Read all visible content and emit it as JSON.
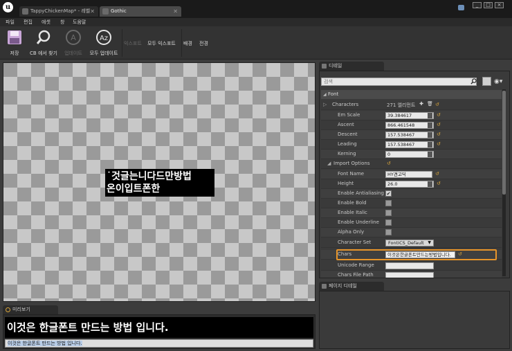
{
  "titlebar": {
    "tabs": [
      {
        "label": "TappyChickenMap* - 레벨"
      },
      {
        "label": "Gothic"
      }
    ],
    "window_controls": [
      "_",
      "□",
      "×"
    ]
  },
  "menu": [
    "파일",
    "편집",
    "애셋",
    "창",
    "도움말"
  ],
  "toolbar": {
    "save": "저장",
    "find_in_cb": "CB 에서 찾기",
    "update": "업데이트",
    "update_all": "모두 업데이트",
    "export": "익스포트",
    "export_all": "모두 익스포트",
    "background": "배경",
    "foreground": "전경"
  },
  "viewport": {
    "atlas_line1": "˙것글는니다드만방법",
    "atlas_line2": "온이입트폰한"
  },
  "preview": {
    "tab_label": "미리보기",
    "render_text": "이것은 한글폰트 만드는 방법 입니다.",
    "input_text": "이것은 한글폰트 만드는 방법 입니다."
  },
  "details": {
    "tab_label": "디테일",
    "search_placeholder": "검색",
    "section": "Font",
    "properties": {
      "characters_label": "Characters",
      "characters_value": "271 엘리먼트",
      "em_scale_label": "Em Scale",
      "em_scale_value": "39.384617",
      "ascent_label": "Ascent",
      "ascent_value": "866.461548",
      "descent_label": "Descent",
      "descent_value": "157.538467",
      "leading_label": "Leading",
      "leading_value": "157.538467",
      "kerning_label": "Kerning",
      "kerning_value": "0",
      "import_options_label": "Import Options",
      "font_name_label": "Font Name",
      "font_name_value": "HY견고딕",
      "height_label": "Height",
      "height_value": "26.0",
      "antialiasing_label": "Enable Antialiasing",
      "bold_label": "Enable Bold",
      "italic_label": "Enable Italic",
      "underline_label": "Enable Underline",
      "alpha_only_label": "Alpha Only",
      "charset_label": "Character Set",
      "charset_value": "FontICS_Default",
      "chars_label": "Chars",
      "chars_value": "이것은한글폰트만드는방법입니다.",
      "unicode_range_label": "Unicode Range",
      "chars_file_path_label": "Chars File Path"
    },
    "checkboxes": {
      "antialiasing": true,
      "bold": false,
      "italic": false,
      "underline": false,
      "alpha_only": false
    }
  },
  "page_details": {
    "tab_label": "페이지 디테일"
  },
  "colors": {
    "highlight": "#e8952a",
    "reset_arrow": "#d8a43a"
  }
}
